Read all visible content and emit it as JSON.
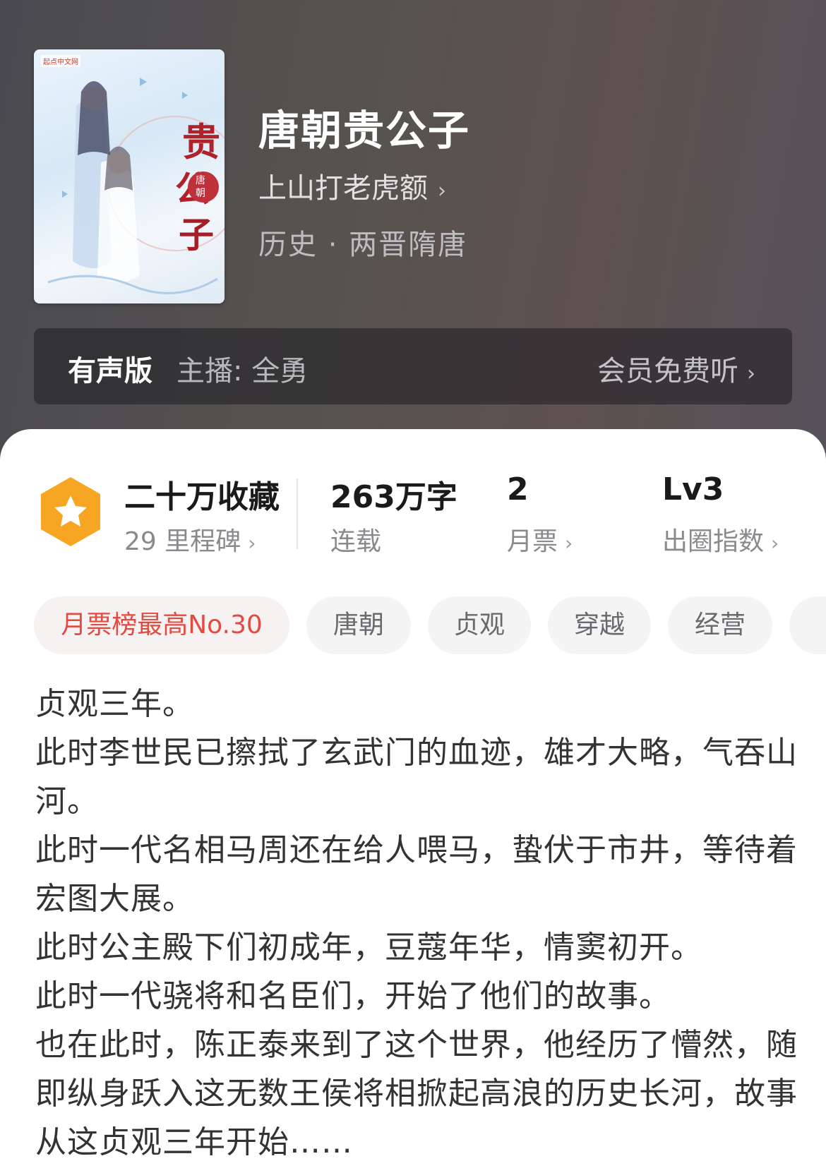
{
  "book": {
    "cover_badge": "起点中文网",
    "title": "唐朝贵公子",
    "author": "上山打老虎额",
    "genre": "历史 · 两晋隋唐"
  },
  "audio": {
    "label": "有声版",
    "host": "主播: 全勇",
    "free_listen": "会员免费听"
  },
  "stats": [
    {
      "main": "二十万收藏",
      "sub": "29 里程碑"
    },
    {
      "main": "263万字",
      "sub": "连载"
    },
    {
      "main": "2",
      "sub": "月票"
    },
    {
      "main": "Lv3",
      "sub": "出圈指数"
    }
  ],
  "tags": [
    "月票榜最高No.30",
    "唐朝",
    "贞观",
    "穿越",
    "经营"
  ],
  "description": [
    "贞观三年。",
    "此时李世民已擦拭了玄武门的血迹，雄才大略，气吞山河。",
    "此时一代名相马周还在给人喂马，蛰伏于市井，等待着宏图大展。",
    "此时公主殿下们初成年，豆蔻年华，情窦初开。",
    "此时一代骁将和名臣们，开始了他们的故事。",
    "也在此时，陈正泰来到了这个世界，他经历了懵然，随即纵身跃入这无数王侯将相掀起高浪的历史长河，故事从这贞观三年开始……"
  ],
  "colors": {
    "accent_red": "#e24b42",
    "badge_orange": "#f6a623"
  }
}
